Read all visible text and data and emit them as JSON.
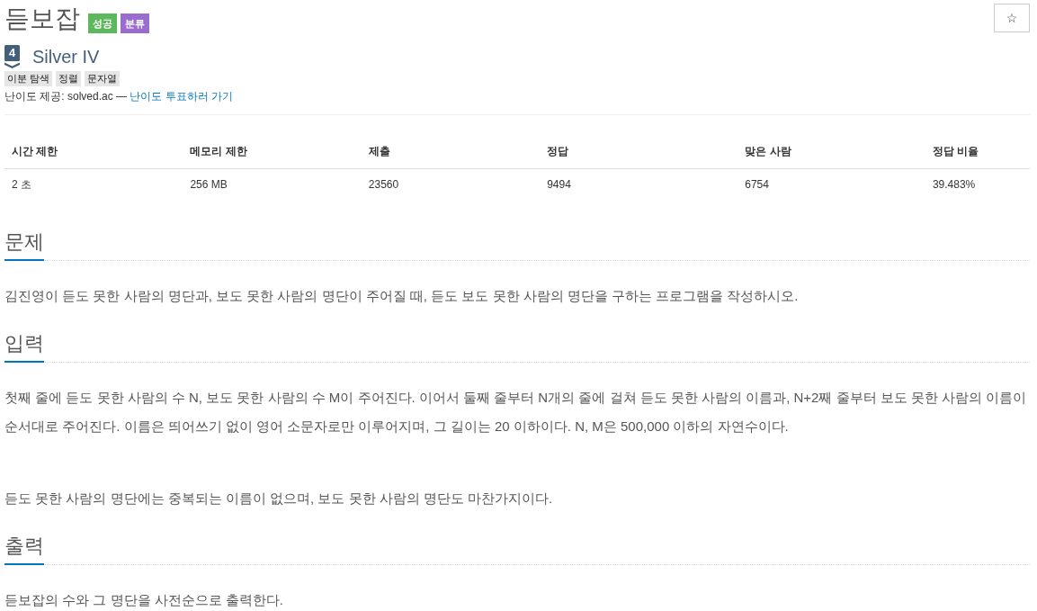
{
  "title": "듣보잡",
  "badges": [
    {
      "label": "성공",
      "color": "#5cb85c"
    },
    {
      "label": "분류",
      "color": "#9a6ccd"
    }
  ],
  "star_button": {
    "label": "☆"
  },
  "tier": {
    "number": "4",
    "name": "Silver IV"
  },
  "tags": [
    "이분 탐색",
    "정렬",
    "문자열"
  ],
  "difficulty_source": {
    "text": "난이도 제공: solved.ac —",
    "link": "난이도 투표하러 가기"
  },
  "stats": {
    "columns": [
      "시간 제한",
      "메모리 제한",
      "제출",
      "정답",
      "맞은 사람",
      "정답 비율"
    ],
    "rows": [
      [
        "2 초",
        "256 MB",
        "23560",
        "9494",
        "6754",
        "39.483%"
      ]
    ]
  },
  "sections": [
    {
      "heading": "문제",
      "paragraphs": [
        "김진영이 듣도 못한 사람의 명단과, 보도 못한 사람의 명단이 주어질 때, 듣도 보도 못한 사람의 명단을 구하는 프로그램을 작성하시오."
      ]
    },
    {
      "heading": "입력",
      "paragraphs": [
        "첫째 줄에 듣도 못한 사람의 수 N, 보도 못한 사람의 수 M이 주어진다. 이어서 둘째 줄부터 N개의 줄에 걸쳐 듣도 못한 사람의 이름과, N+2째 줄부터 보도 못한 사람의 이름이 순서대로 주어진다. 이름은 띄어쓰기 없이 영어 소문자로만 이루어지며, 그 길이는 20 이하이다. N, M은 500,000 이하의 자연수이다.",
        "듣도 못한 사람의 명단에는 중복되는 이름이 없으며, 보도 못한 사람의 명단도 마찬가지이다."
      ]
    },
    {
      "heading": "출력",
      "paragraphs": [
        "듣보잡의 수와 그 명단을 사전순으로 출력한다."
      ]
    }
  ]
}
